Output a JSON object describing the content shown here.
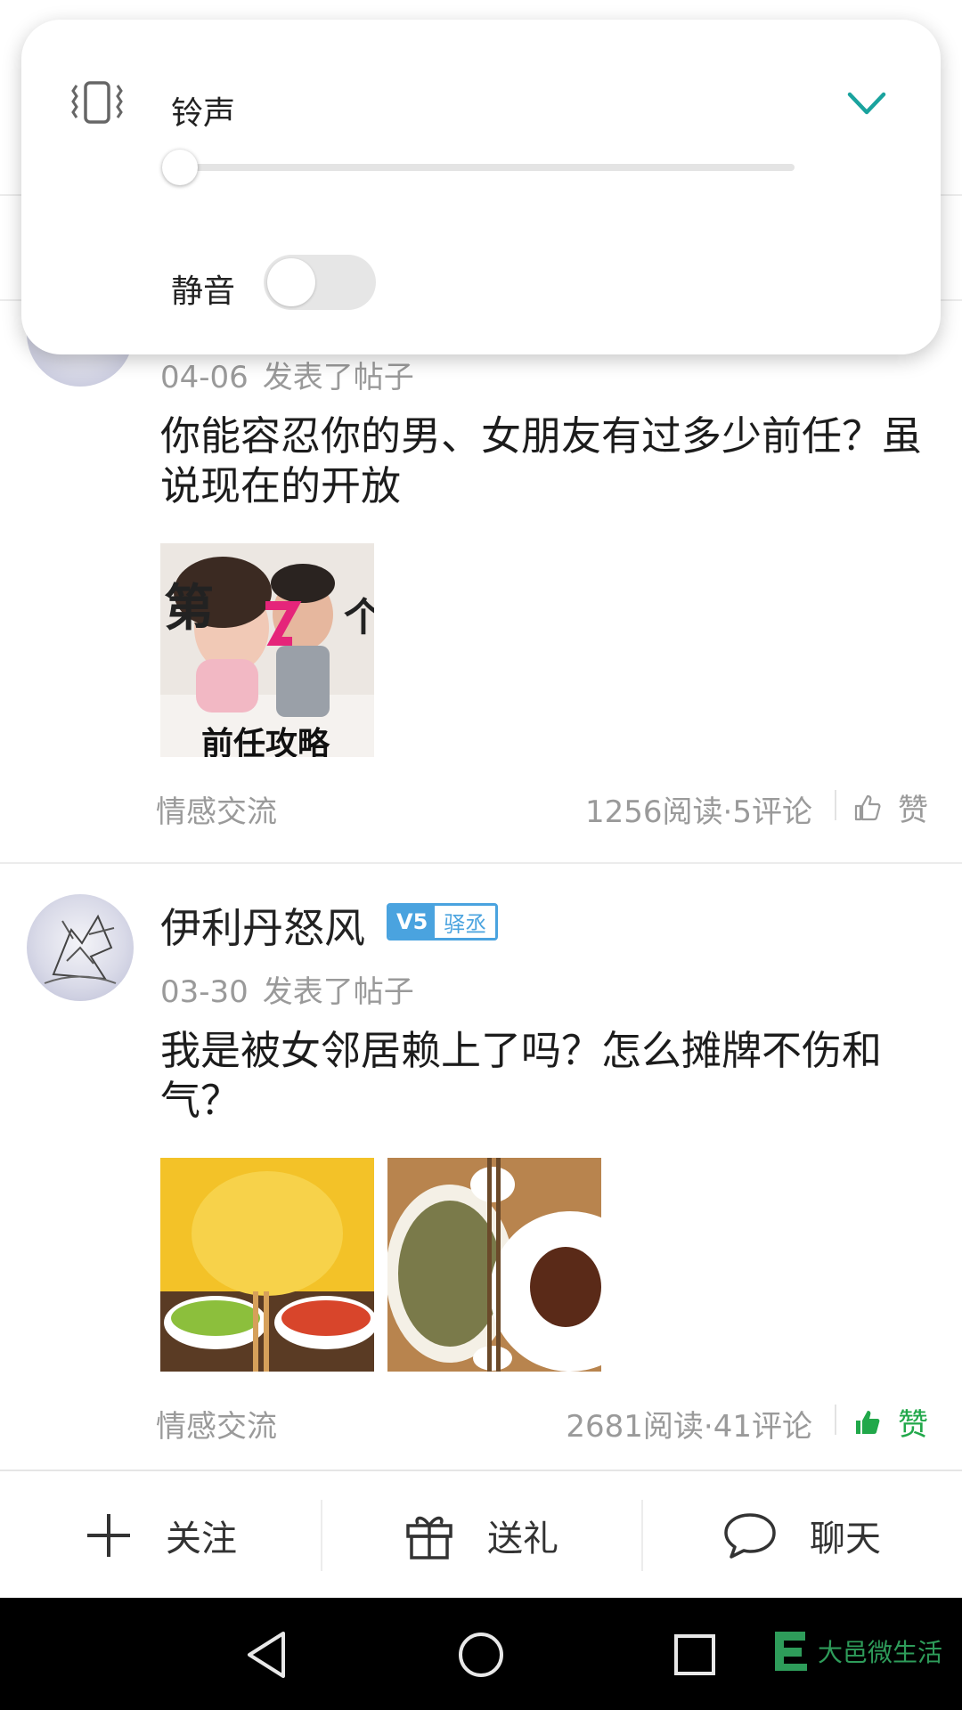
{
  "volume_panel": {
    "label": "铃声",
    "level": 0,
    "mute_label": "静音",
    "mute_on": false,
    "icon": "vibrate-icon",
    "accent_color": "#1aa39e"
  },
  "posts": [
    {
      "date": "04-06",
      "action": "发表了帖子",
      "title": "你能容忍你的男、女朋友有过多少前任？虽说现在的开放",
      "thumbnail_text": "前任攻略",
      "category": "情感交流",
      "stats": "1256阅读·5评论",
      "like_label": "赞",
      "liked": false
    },
    {
      "username": "伊利丹怒风",
      "badge_level": "V5",
      "badge_title": "驿丞",
      "date": "03-30",
      "action": "发表了帖子",
      "title": "我是被女邻居赖上了吗？怎么摊牌不伤和气？",
      "category": "情感交流",
      "stats": "2681阅读·41评论",
      "like_label": "赞",
      "liked": true
    }
  ],
  "action_bar": {
    "follow": "关注",
    "gift": "送礼",
    "chat": "聊天"
  },
  "watermark": "大邑微生活",
  "colors": {
    "like_active": "#21a84a",
    "badge": "#4aa3df"
  }
}
